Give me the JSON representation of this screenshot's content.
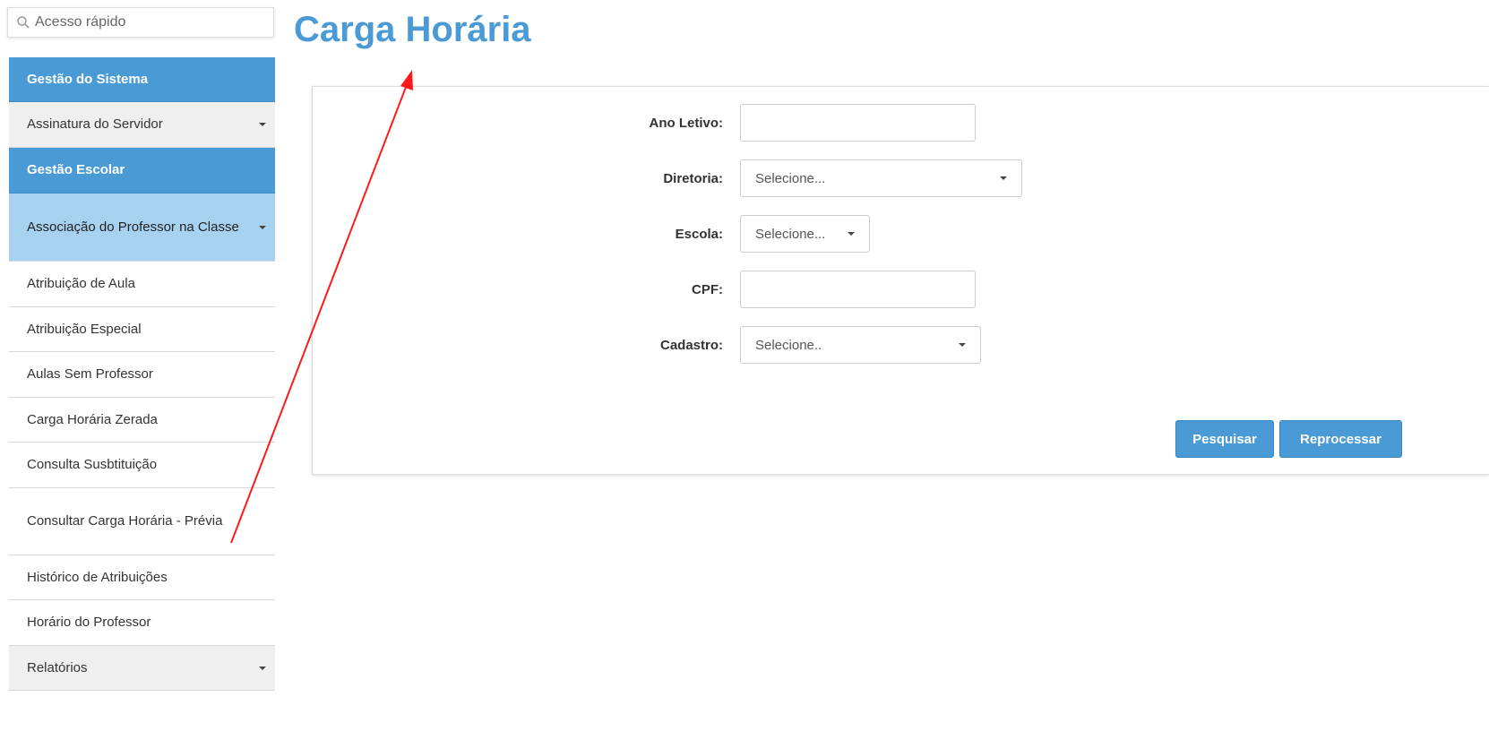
{
  "search": {
    "placeholder": "Acesso rápido",
    "icon": "search-icon"
  },
  "sidebar": {
    "items": [
      {
        "label": "Gestão do Sistema",
        "type": "section"
      },
      {
        "label": "Assinatura do Servidor",
        "type": "group",
        "icon": "caret-down-icon"
      },
      {
        "label": "Gestão Escolar",
        "type": "section"
      },
      {
        "label": "Associação do Professor na Classe",
        "type": "open",
        "icon": "caret-down-icon"
      },
      {
        "label": "Atribuição de Aula",
        "type": "link"
      },
      {
        "label": "Atribuição Especial",
        "type": "link"
      },
      {
        "label": "Aulas Sem Professor",
        "type": "link"
      },
      {
        "label": "Carga Horária Zerada",
        "type": "link"
      },
      {
        "label": "Consulta Susbtituição",
        "type": "link"
      },
      {
        "label": "Consultar Carga Horária - Prévia",
        "type": "link"
      },
      {
        "label": "Histórico de Atribuições",
        "type": "link"
      },
      {
        "label": "Horário do Professor",
        "type": "link"
      },
      {
        "label": "Relatórios",
        "type": "group",
        "icon": "caret-down-icon"
      }
    ]
  },
  "page": {
    "title": "Carga Horária"
  },
  "form": {
    "ano_letivo": {
      "label": "Ano Letivo:",
      "value": ""
    },
    "diretoria": {
      "label": "Diretoria:",
      "value": "Selecione..."
    },
    "escola": {
      "label": "Escola:",
      "value": "Selecione..."
    },
    "cpf": {
      "label": "CPF:",
      "value": ""
    },
    "cadastro": {
      "label": "Cadastro:",
      "value": "Selecione.."
    }
  },
  "buttons": {
    "pesquisar": "Pesquisar",
    "reprocessar": "Reprocessar"
  },
  "colors": {
    "accent": "#4a9bd5",
    "sidebar_open": "#a6d2ef",
    "annotation_arrow": "#ff0000"
  }
}
